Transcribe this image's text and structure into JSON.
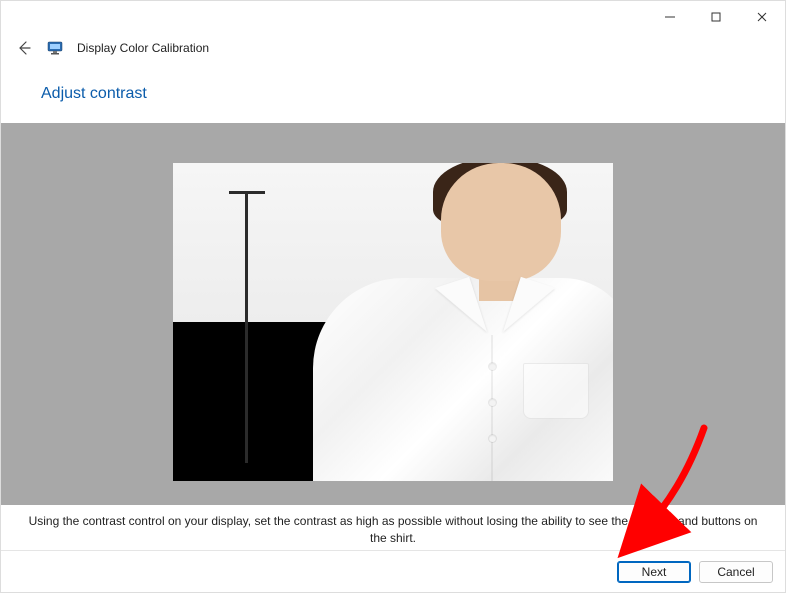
{
  "window": {
    "title": "Display Color Calibration"
  },
  "header": {
    "heading": "Adjust contrast"
  },
  "instruction": {
    "text": "Using the contrast control on your display, set the contrast as high as possible without losing the ability to see the wrinkles and buttons on the shirt."
  },
  "buttons": {
    "next": "Next",
    "cancel": "Cancel"
  }
}
